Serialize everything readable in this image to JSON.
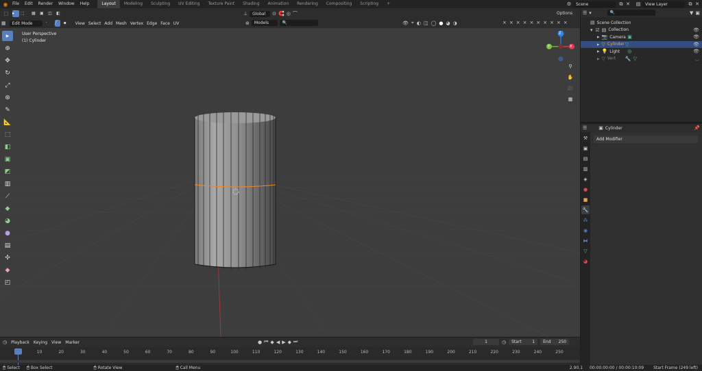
{
  "topbar": {
    "menu": [
      "File",
      "Edit",
      "Render",
      "Window",
      "Help"
    ],
    "workspaces": [
      "Layout",
      "Modeling",
      "Sculpting",
      "UV Editing",
      "Texture Paint",
      "Shading",
      "Animation",
      "Rendering",
      "Compositing",
      "Scripting"
    ],
    "active_workspace": "Layout",
    "add_tab": "+",
    "scene": "Scene",
    "view_layer": "View Layer"
  },
  "viewport": {
    "mode": "Edit Mode",
    "menus": [
      "View",
      "Select",
      "Add",
      "Mesh",
      "Vertex",
      "Edge",
      "Face",
      "UV"
    ],
    "orientation": "Global",
    "snap_target": "Models",
    "options": "Options",
    "overlay_line1": "User Perspective",
    "overlay_line2": "(1) Cylinder",
    "axis_x": "X",
    "axis_y": "Y",
    "axis_z": "Z"
  },
  "outliner": {
    "root": "Scene Collection",
    "collection": "Collection",
    "items": [
      {
        "label": "Camera",
        "icon": "camera-icon",
        "selected": false
      },
      {
        "label": "Cylinder",
        "icon": "mesh-icon",
        "selected": true
      },
      {
        "label": "Light",
        "icon": "light-icon",
        "selected": false
      },
      {
        "label": "Vert",
        "icon": "mesh-icon",
        "selected": false
      }
    ]
  },
  "properties": {
    "object_name": "Cylinder",
    "add_modifier": "Add Modifier"
  },
  "timeline": {
    "menus": [
      "Playback",
      "Keying",
      "View",
      "Marker"
    ],
    "current_frame": "1",
    "start_label": "Start",
    "start": "1",
    "end_label": "End",
    "end": "250",
    "ticks": [
      "1",
      "10",
      "20",
      "30",
      "40",
      "50",
      "60",
      "70",
      "80",
      "90",
      "100",
      "110",
      "120",
      "130",
      "140",
      "150",
      "160",
      "170",
      "180",
      "190",
      "200",
      "210",
      "220",
      "230",
      "240",
      "250"
    ]
  },
  "status": {
    "left": [
      "Select",
      "Box Select",
      "Rotate View",
      "Call Menu"
    ],
    "version": "2.90.1",
    "time": "00:00:00:00 / 00:00:10:09",
    "frame_info": "Start Frame (249 left)"
  },
  "colors": {
    "accent": "#5680c2",
    "selection": "#334d80",
    "axis_x": "#e83b51",
    "axis_y": "#7fc53b",
    "axis_z": "#2f86e6",
    "edge_select": "#f08a24"
  }
}
